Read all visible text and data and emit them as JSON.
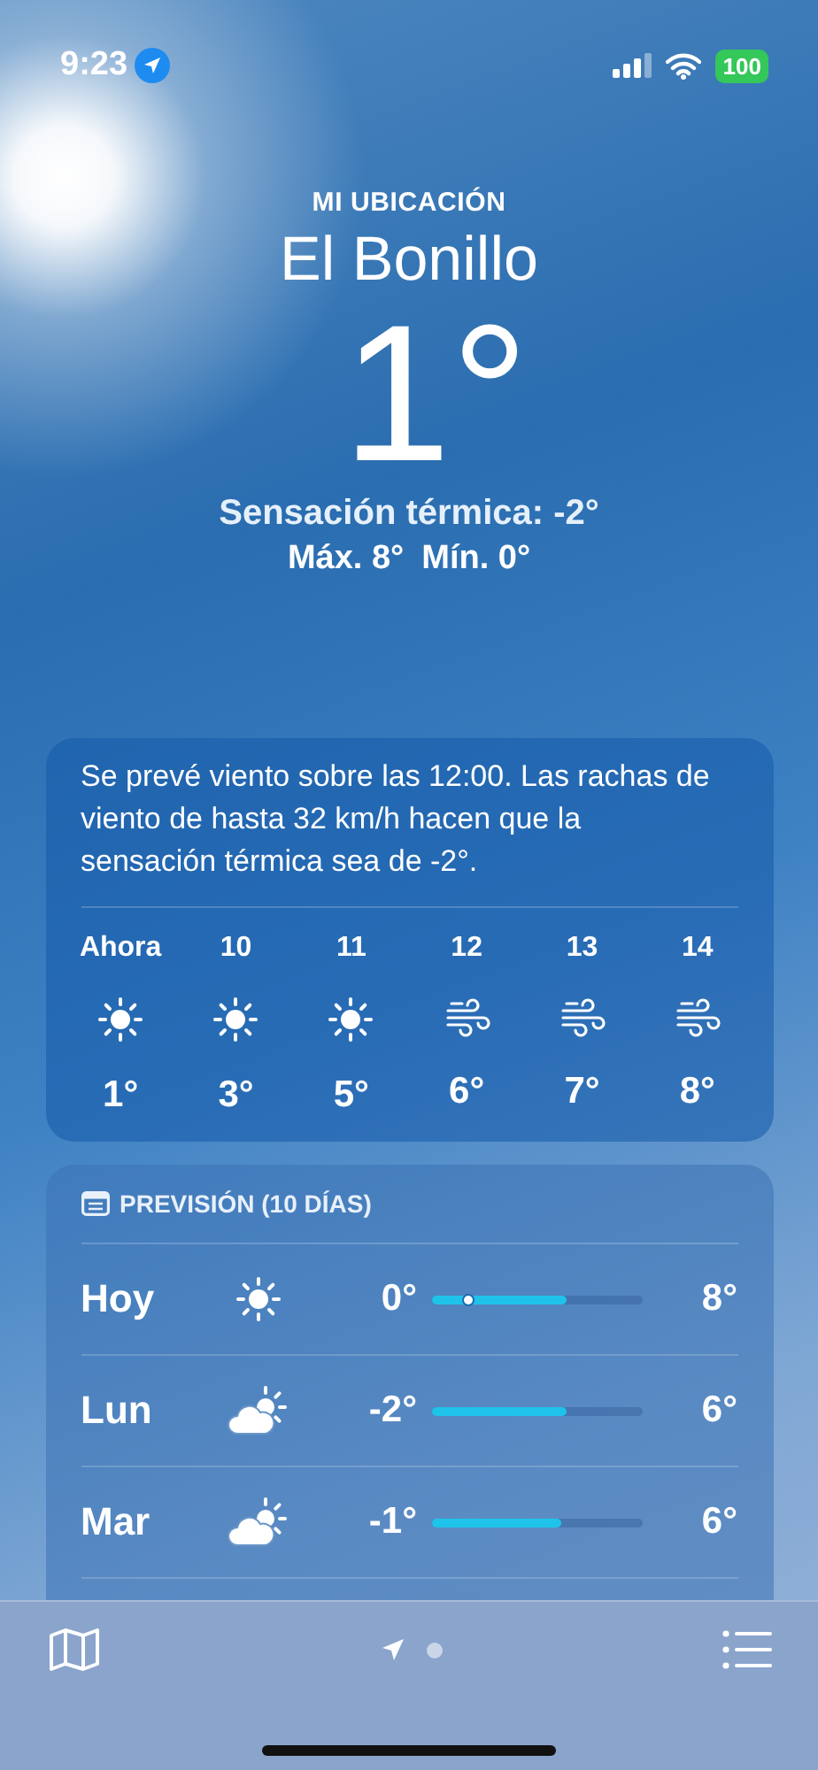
{
  "status_bar": {
    "time": "9:23",
    "battery": "100"
  },
  "location": {
    "label": "MI UBICACIÓN",
    "city": "El Bonillo",
    "temperature": "1°",
    "feels_like": "Sensación térmica: -2°",
    "high": "Máx. 8°",
    "low": "Mín. 0°"
  },
  "hourly": {
    "summary": "Se prevé viento sobre las 12:00. Las rachas de viento de hasta 32 km/h hacen que la sensación térmica sea de -2°.",
    "hours": [
      {
        "time": "Ahora",
        "kind": "sun",
        "temp": "1°"
      },
      {
        "time": "10",
        "kind": "sun",
        "temp": "3°"
      },
      {
        "time": "11",
        "kind": "sun",
        "temp": "5°"
      },
      {
        "time": "12",
        "kind": "wind",
        "temp": "6°"
      },
      {
        "time": "13",
        "kind": "wind",
        "temp": "7°"
      },
      {
        "time": "14",
        "kind": "wind",
        "temp": "8°"
      }
    ]
  },
  "forecast": {
    "title": "PREVISIÓN (10 DÍAS)",
    "days": [
      {
        "day": "Hoy",
        "kind": "sun",
        "low": "0°",
        "high": "8°",
        "level": 0.64,
        "current": true
      },
      {
        "day": "Lun",
        "kind": "partly_cloudy",
        "low": "-2°",
        "high": "6°",
        "level": 0.64,
        "current": false
      },
      {
        "day": "Mar",
        "kind": "partly_cloudy",
        "low": "-1°",
        "high": "6°",
        "level": 0.62,
        "current": false
      }
    ]
  },
  "pager": {
    "pages": [
      {
        "kind": "location",
        "selected": true
      },
      {
        "kind": "dot",
        "selected": false
      }
    ]
  }
}
